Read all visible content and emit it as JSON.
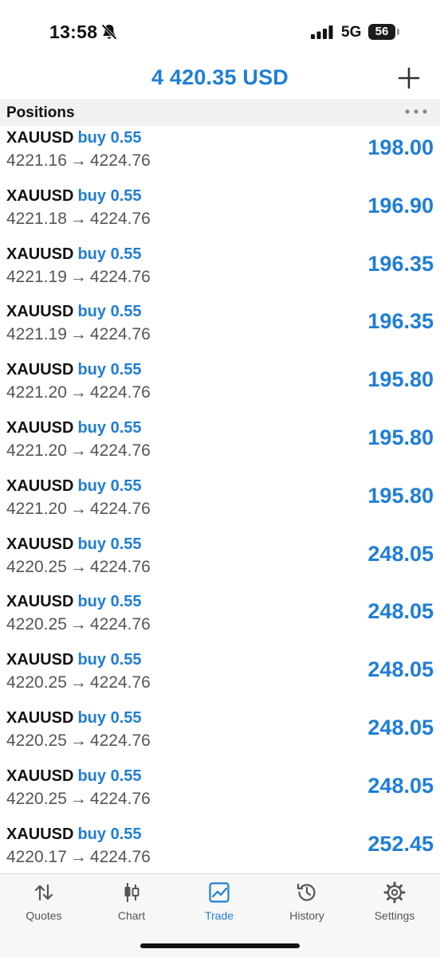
{
  "status_bar": {
    "time": "13:58",
    "network": "5G",
    "battery": "56",
    "icons": [
      "bell-slash-icon",
      "signal-icon"
    ]
  },
  "header": {
    "balance": "4 420.35 USD",
    "add_icon": "plus-icon"
  },
  "section": {
    "title": "Positions",
    "more_icon": "ellipsis-icon"
  },
  "positions": [
    {
      "symbol": "XAUUSD",
      "side": "buy 0.55",
      "open": "4221.16",
      "arrow": "→",
      "current": "4224.76",
      "profit": "198.00"
    },
    {
      "symbol": "XAUUSD",
      "side": "buy 0.55",
      "open": "4221.18",
      "arrow": "→",
      "current": "4224.76",
      "profit": "196.90"
    },
    {
      "symbol": "XAUUSD",
      "side": "buy 0.55",
      "open": "4221.19",
      "arrow": "→",
      "current": "4224.76",
      "profit": "196.35"
    },
    {
      "symbol": "XAUUSD",
      "side": "buy 0.55",
      "open": "4221.19",
      "arrow": "→",
      "current": "4224.76",
      "profit": "196.35"
    },
    {
      "symbol": "XAUUSD",
      "side": "buy 0.55",
      "open": "4221.20",
      "arrow": "→",
      "current": "4224.76",
      "profit": "195.80"
    },
    {
      "symbol": "XAUUSD",
      "side": "buy 0.55",
      "open": "4221.20",
      "arrow": "→",
      "current": "4224.76",
      "profit": "195.80"
    },
    {
      "symbol": "XAUUSD",
      "side": "buy 0.55",
      "open": "4221.20",
      "arrow": "→",
      "current": "4224.76",
      "profit": "195.80"
    },
    {
      "symbol": "XAUUSD",
      "side": "buy 0.55",
      "open": "4220.25",
      "arrow": "→",
      "current": "4224.76",
      "profit": "248.05"
    },
    {
      "symbol": "XAUUSD",
      "side": "buy 0.55",
      "open": "4220.25",
      "arrow": "→",
      "current": "4224.76",
      "profit": "248.05"
    },
    {
      "symbol": "XAUUSD",
      "side": "buy 0.55",
      "open": "4220.25",
      "arrow": "→",
      "current": "4224.76",
      "profit": "248.05"
    },
    {
      "symbol": "XAUUSD",
      "side": "buy 0.55",
      "open": "4220.25",
      "arrow": "→",
      "current": "4224.76",
      "profit": "248.05"
    },
    {
      "symbol": "XAUUSD",
      "side": "buy 0.55",
      "open": "4220.25",
      "arrow": "→",
      "current": "4224.76",
      "profit": "248.05"
    },
    {
      "symbol": "XAUUSD",
      "side": "buy 0.55",
      "open": "4220.17",
      "arrow": "→",
      "current": "4224.76",
      "profit": "252.45"
    }
  ],
  "tabs": [
    {
      "label": "Quotes",
      "icon": "quotes-arrows-icon",
      "active": false
    },
    {
      "label": "Chart",
      "icon": "candlestick-icon",
      "active": false
    },
    {
      "label": "Trade",
      "icon": "trade-chart-icon",
      "active": true
    },
    {
      "label": "History",
      "icon": "history-clock-icon",
      "active": false
    },
    {
      "label": "Settings",
      "icon": "gear-icon",
      "active": false
    }
  ],
  "colors": {
    "accent": "#1f7ed6",
    "text": "#111111",
    "secondary_text": "#555555",
    "section_bg": "#f1f1f3"
  }
}
